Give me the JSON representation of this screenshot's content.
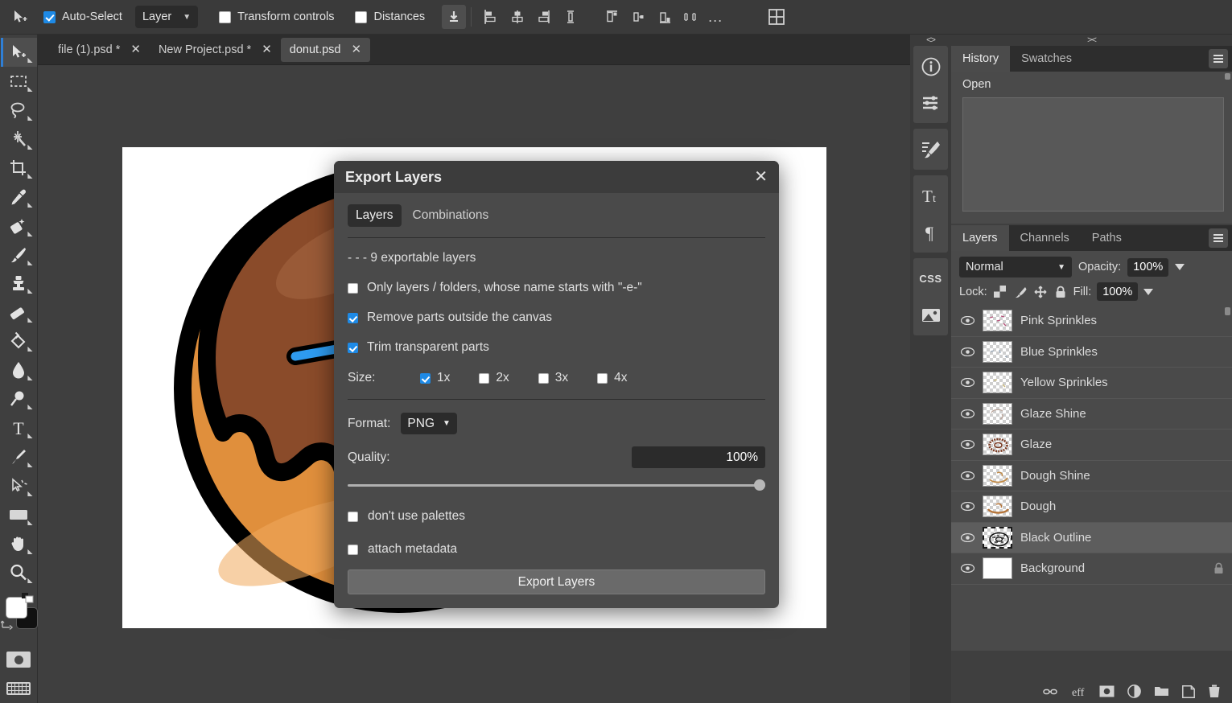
{
  "options_bar": {
    "move_tool_icon": "move-tool-icon",
    "auto_select_label": "Auto-Select",
    "auto_select_checked": true,
    "layer_select_value": "Layer",
    "transform_controls_label": "Transform controls",
    "transform_controls_checked": false,
    "distances_label": "Distances",
    "distances_checked": false,
    "buttons": [
      {
        "name": "distribute-download-icon"
      },
      {
        "name": "align-left-edges-icon"
      },
      {
        "name": "align-horizontal-centers-icon"
      },
      {
        "name": "align-right-edges-icon"
      },
      {
        "name": "align-vertical-distribute-icon"
      },
      {
        "name": "align-top-edges-icon"
      },
      {
        "name": "align-vertical-centers-icon"
      },
      {
        "name": "align-bottom-edges-icon"
      },
      {
        "name": "distribute-horizontal-icon"
      }
    ],
    "more_label": "...",
    "grid_icon": "grid-layout-icon"
  },
  "toolbar": {
    "tools": [
      {
        "name": "move-tool",
        "selected": true
      },
      {
        "name": "rectangular-marquee-tool",
        "selected": false
      },
      {
        "name": "lasso-tool",
        "selected": false
      },
      {
        "name": "magic-wand-tool",
        "selected": false
      },
      {
        "name": "crop-tool",
        "selected": false
      },
      {
        "name": "eyedropper-tool",
        "selected": false
      },
      {
        "name": "patch-tool",
        "selected": false
      },
      {
        "name": "brush-tool",
        "selected": false
      },
      {
        "name": "clone-stamp-tool",
        "selected": false
      },
      {
        "name": "eraser-tool",
        "selected": false
      },
      {
        "name": "paint-bucket-tool",
        "selected": false
      },
      {
        "name": "blur-tool",
        "selected": false
      },
      {
        "name": "dodge-tool",
        "selected": false
      },
      {
        "name": "type-tool",
        "selected": false
      },
      {
        "name": "pen-tool",
        "selected": false
      },
      {
        "name": "path-selection-tool",
        "selected": false
      },
      {
        "name": "shape-tool",
        "selected": false
      },
      {
        "name": "hand-tool",
        "selected": false
      },
      {
        "name": "zoom-tool",
        "selected": false
      }
    ],
    "foreground_color": "#ffffff",
    "background_color": "#111111",
    "swap-colors-icon": "swap-colors-icon",
    "quick-mask-icon": "quick-mask-icon",
    "keyboard-icon": "keyboard-icon"
  },
  "document_tabs": [
    {
      "label": "file (1).psd *",
      "active": false
    },
    {
      "label": "New Project.psd *",
      "active": false
    },
    {
      "label": "donut.psd",
      "active": true
    }
  ],
  "right_rail": {
    "top_handle": "<>",
    "items": [
      {
        "name": "info-icon"
      },
      {
        "name": "adjustments-icon"
      },
      {
        "name": "brush-settings-icon"
      },
      {
        "name": "character-icon"
      },
      {
        "name": "paragraph-icon"
      },
      {
        "name": "css-icon"
      },
      {
        "name": "image-icon"
      }
    ],
    "css_label": "CSS"
  },
  "history_panel": {
    "grip": "><",
    "tabs": [
      {
        "label": "History",
        "active": true
      },
      {
        "label": "Swatches",
        "active": false
      }
    ],
    "menu_icon": "panel-menu-icon",
    "items": [
      "Open"
    ]
  },
  "layers_panel": {
    "tabs": [
      {
        "label": "Layers",
        "active": true
      },
      {
        "label": "Channels",
        "active": false
      },
      {
        "label": "Paths",
        "active": false
      }
    ],
    "menu_icon": "panel-menu-icon",
    "blend_mode": "Normal",
    "opacity_label": "Opacity:",
    "opacity_value": "100%",
    "lock_label": "Lock:",
    "lock_icons": [
      "lock-transparent-pixels-icon",
      "lock-image-pixels-icon",
      "lock-position-icon",
      "lock-all-icon"
    ],
    "fill_label": "Fill:",
    "fill_value": "100%",
    "layers": [
      {
        "name": "Pink Sprinkles",
        "visible": true,
        "selected": false,
        "locked": false
      },
      {
        "name": "Blue Sprinkles",
        "visible": true,
        "selected": false,
        "locked": false
      },
      {
        "name": "Yellow Sprinkles",
        "visible": true,
        "selected": false,
        "locked": false
      },
      {
        "name": "Glaze Shine",
        "visible": true,
        "selected": false,
        "locked": false
      },
      {
        "name": "Glaze",
        "visible": true,
        "selected": false,
        "locked": false
      },
      {
        "name": "Dough Shine",
        "visible": true,
        "selected": false,
        "locked": false
      },
      {
        "name": "Dough",
        "visible": true,
        "selected": false,
        "locked": false
      },
      {
        "name": "Black Outline",
        "visible": true,
        "selected": true,
        "locked": false
      },
      {
        "name": "Background",
        "visible": true,
        "selected": false,
        "locked": true
      }
    ],
    "footer_icons": [
      {
        "name": "link-layers-icon"
      },
      {
        "name": "layer-effects-icon"
      },
      {
        "name": "layer-mask-icon"
      },
      {
        "name": "adjustment-layer-icon"
      },
      {
        "name": "new-group-icon"
      },
      {
        "name": "new-layer-icon"
      },
      {
        "name": "delete-layer-icon"
      }
    ]
  },
  "export_dialog": {
    "title": "Export Layers",
    "close_icon": "close-icon",
    "tabs": [
      {
        "label": "Layers",
        "active": true
      },
      {
        "label": "Combinations",
        "active": false
      }
    ],
    "layer_count_text": "- - - 9 exportable layers",
    "options": [
      {
        "label": "Only layers / folders, whose name starts with \"-e-\"",
        "checked": false
      },
      {
        "label": "Remove parts outside the canvas",
        "checked": true
      },
      {
        "label": "Trim transparent parts",
        "checked": true
      }
    ],
    "size_label": "Size:",
    "sizes": [
      {
        "label": "1x",
        "checked": true
      },
      {
        "label": "2x",
        "checked": false
      },
      {
        "label": "3x",
        "checked": false
      },
      {
        "label": "4x",
        "checked": false
      }
    ],
    "format_label": "Format:",
    "format_value": "PNG",
    "quality_label": "Quality:",
    "quality_value": "100%",
    "quality_percent": 100,
    "extra_options": [
      {
        "label": "don't use palettes",
        "checked": false
      },
      {
        "label": "attach metadata",
        "checked": false
      }
    ],
    "submit_label": "Export Layers"
  },
  "colors": {
    "accent": "#1e8ae6",
    "panel_bg": "#4a4a4a",
    "app_bg": "#3f3f3f",
    "dark_field": "#2b2b2b",
    "dough": "#e08f3c",
    "glaze": "#8a4b2a",
    "outline": "#000000",
    "sprinkle_pink": "#ef3e7c",
    "sprinkle_blue": "#2e9bf0",
    "sprinkle_yellow": "#ffd73e"
  }
}
